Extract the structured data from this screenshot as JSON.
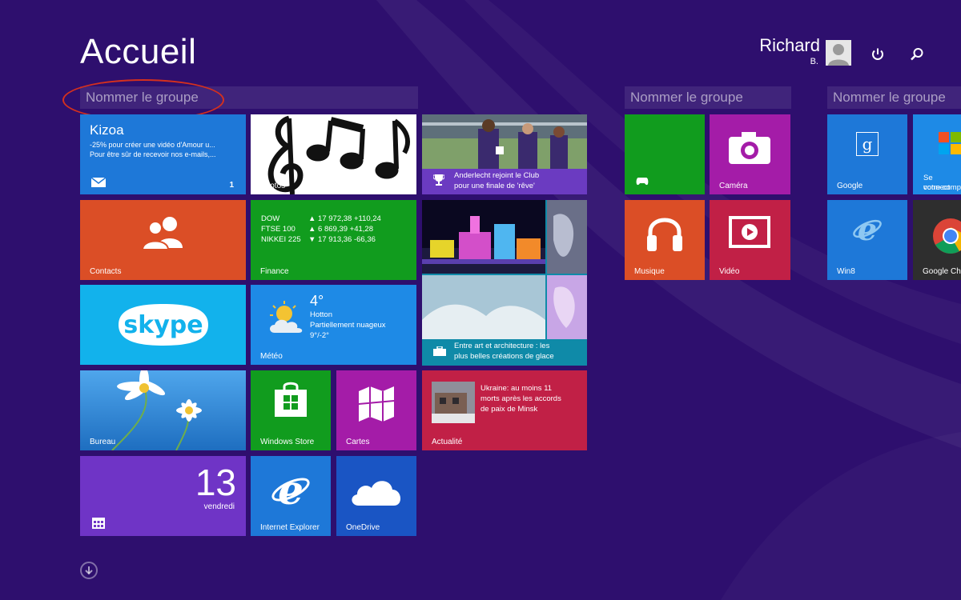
{
  "screen": {
    "title": "Accueil"
  },
  "user": {
    "name": "Richard",
    "initial": "B."
  },
  "groups": [
    {
      "header": "Nommer le groupe"
    },
    {
      "header": "Nommer le groupe"
    },
    {
      "header": "Nommer le groupe"
    }
  ],
  "tiles": {
    "mail": {
      "title": "Kizoa",
      "line1": "-25% pour créer une vidéo d'Amour u...",
      "line2": "Pour être sûr de recevoir nos e-mails,...",
      "count": "1"
    },
    "photos": {
      "label": "Photos"
    },
    "sport": {
      "headline1": "Anderlecht rejoint le Club",
      "headline2": "pour une finale de 'rêve'"
    },
    "contacts": {
      "label": "Contacts"
    },
    "finance": {
      "label": "Finance",
      "rows": [
        {
          "name": "DOW",
          "value": "▲ 17 972,38 +110,24"
        },
        {
          "name": "FTSE 100",
          "value": "▲ 6 869,39 +41,28"
        },
        {
          "name": "NIKKEI 225",
          "value": "▼ 17 913,36 -66,36"
        }
      ]
    },
    "travel": {
      "caption1": "Entre art et architecture : les",
      "caption2": "plus belles créations de glace"
    },
    "skype": {
      "label": "skype"
    },
    "meteo": {
      "temp": "4°",
      "city": "Hotton",
      "condition": "Partiellement nuageux",
      "range": "9°/-2°",
      "label": "Météo"
    },
    "bureau": {
      "label": "Bureau"
    },
    "store": {
      "label": "Windows Store"
    },
    "cartes": {
      "label": "Cartes"
    },
    "news": {
      "line1": "Ukraine: au moins 11",
      "line2": "morts après les accords",
      "line3": "de paix de Minsk",
      "label": "Actualité"
    },
    "calendar": {
      "day": "13",
      "weekday": "vendredi"
    },
    "ie": {
      "label": "Internet Explorer"
    },
    "onedrive": {
      "label": "OneDrive"
    },
    "xbox": {
      "label": ""
    },
    "camera": {
      "label": "Caméra"
    },
    "musique": {
      "label": "Musique"
    },
    "video": {
      "label": "Vidéo"
    },
    "google": {
      "label": "Google"
    },
    "connect": {
      "line1": "Se connect",
      "line2": "votre comp"
    },
    "win8": {
      "label": "Win8"
    },
    "chrome": {
      "label": "Google Ch"
    }
  },
  "colors": {
    "background": "#2e0f6e",
    "mail": "#1e78d8",
    "contacts": "#db4e26",
    "finance": "#119c1e",
    "skype": "#12b2ec",
    "meteo": "#1e8ae6",
    "store": "#119c1e",
    "cartes": "#a41ca8",
    "news": "#c12046",
    "calendar": "#6f34c6",
    "ie": "#1e78d8",
    "onedrive": "#1a55c4",
    "xbox": "#119c1e",
    "camera": "#a41ca8",
    "musique": "#db4e26",
    "video": "#c12046",
    "google": "#1e78d8",
    "annotation": "#d4301e"
  }
}
